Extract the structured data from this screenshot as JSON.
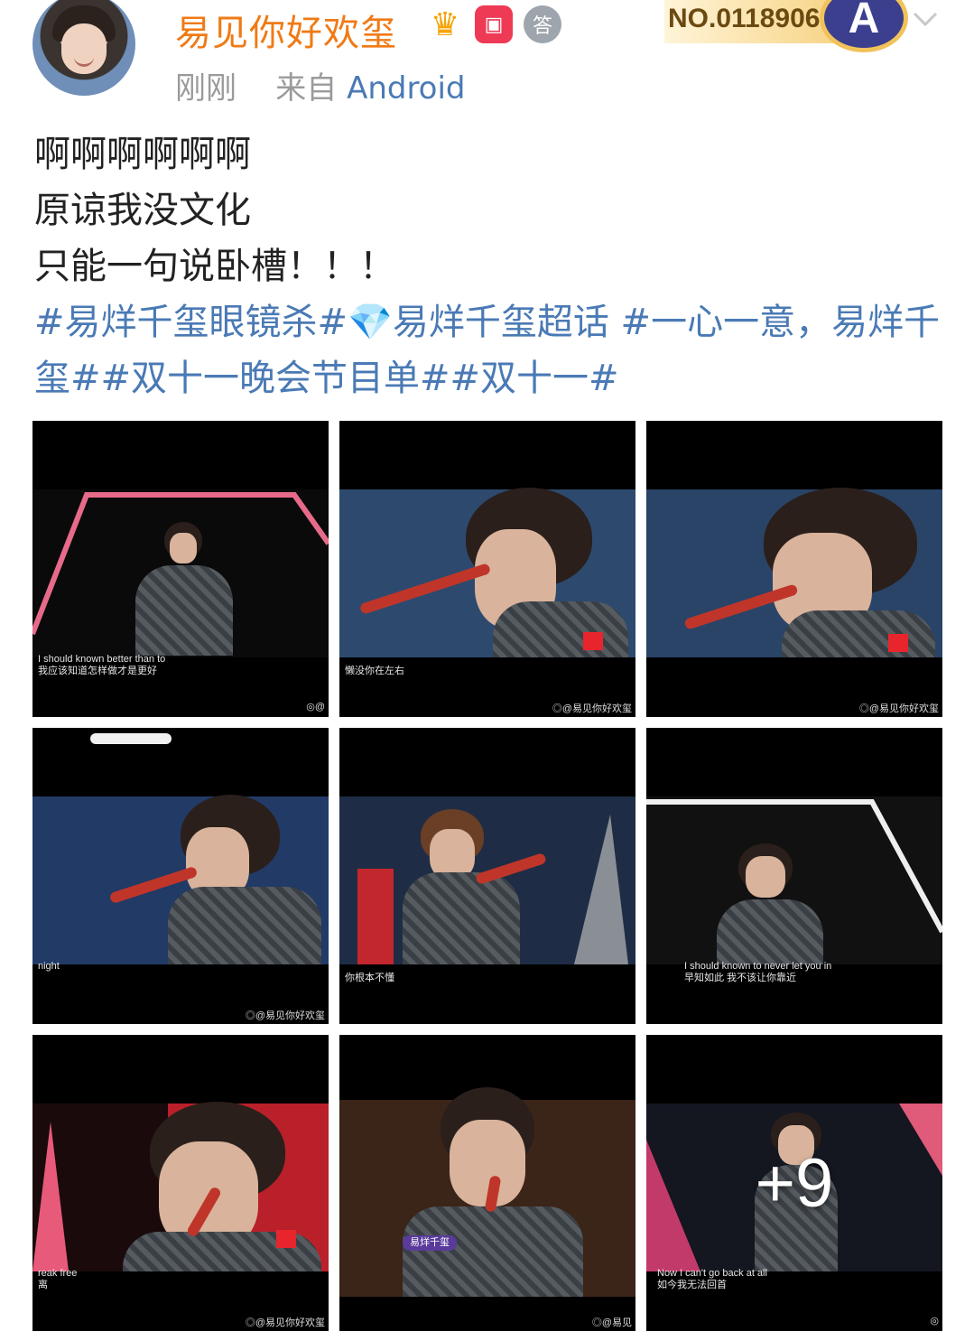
{
  "header": {
    "username": "易见你好欢玺",
    "time": "刚刚",
    "from_prefix": "来自",
    "source": "Android",
    "fan_number": "NO.0118906",
    "emblem_letter": "A"
  },
  "post": {
    "lines": [
      "啊啊啊啊啊啊",
      "原谅我没文化",
      "只能一句说卧槽！！！"
    ],
    "topics": "#易烊千玺眼镜杀#💎易烊千玺超话 #一心一意，易烊千玺##双十一晚会节目单##双十一#"
  },
  "images": [
    {
      "sub1": "I should known better than to",
      "sub2": "我应该知道怎样做才是更好",
      "wm": "◎@"
    },
    {
      "sub1": "",
      "sub2": "懒没你在左右",
      "wm": "◎@易见你好欢玺"
    },
    {
      "sub1": "",
      "sub2": "",
      "wm": "◎@易见你好欢玺"
    },
    {
      "sub1": "night",
      "sub2": "",
      "wm": "◎@易见你好欢玺"
    },
    {
      "sub1": "",
      "sub2": "你根本不懂",
      "wm": ""
    },
    {
      "sub1": "I should known to never let you in",
      "sub2": "早知如此 我不该让你靠近",
      "wm": ""
    },
    {
      "sub1": "reak free",
      "sub2": "离",
      "wm": "◎@易见你好欢玺"
    },
    {
      "sub1": "易烊千玺",
      "sub2": "",
      "wm": "◎@易见"
    },
    {
      "sub1": "Now I can't go back at all",
      "sub2": "如今我无法回首",
      "wm": "◎"
    }
  ],
  "more_count": "+9"
}
